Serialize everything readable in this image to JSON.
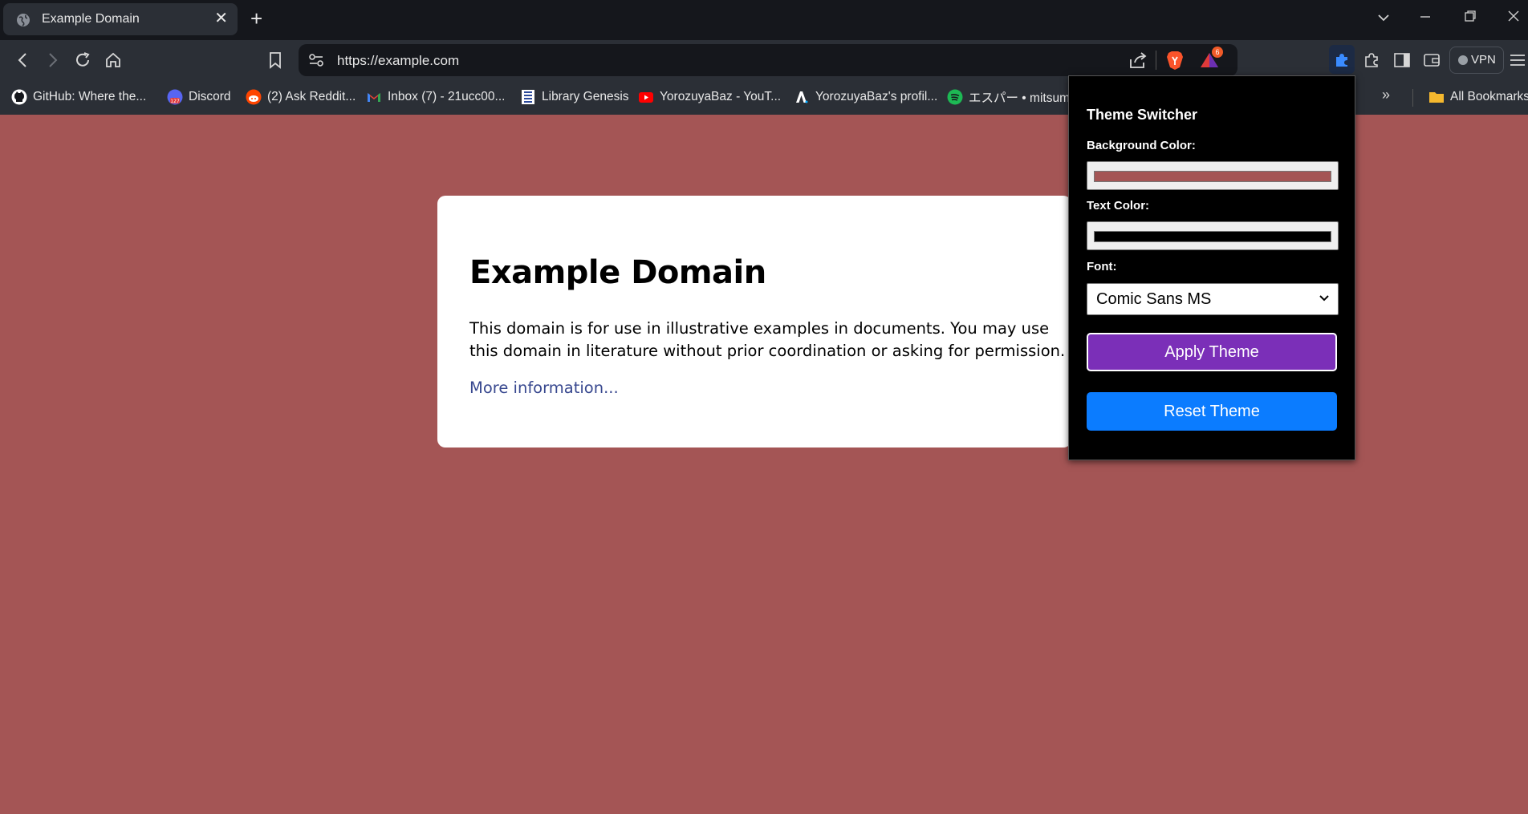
{
  "tab": {
    "title": "Example Domain"
  },
  "address_bar": {
    "url": "https://example.com",
    "brave_badge_count": "6"
  },
  "toolbar": {
    "vpn_label": "VPN"
  },
  "bookmarks": [
    {
      "label": "GitHub: Where the...",
      "icon": "github-icon"
    },
    {
      "label": "Discord",
      "icon": "discord-icon"
    },
    {
      "label": "(2) Ask Reddit...",
      "icon": "reddit-icon"
    },
    {
      "label": "Inbox (7) - 21ucc00...",
      "icon": "gmail-icon"
    },
    {
      "label": "Library Genesis",
      "icon": "libgen-icon"
    },
    {
      "label": "YorozuyaBaz - YouT...",
      "icon": "youtube-icon"
    },
    {
      "label": "YorozuyaBaz's profil...",
      "icon": "anilist-icon"
    },
    {
      "label": "エスパー • mitsume",
      "icon": "spotify-icon"
    }
  ],
  "bookmarks_all": "All Bookmarks",
  "page": {
    "heading": "Example Domain",
    "paragraph": "This domain is for use in illustrative examples in documents. You may use this domain in literature without prior coordination or asking for permission.",
    "link": "More information..."
  },
  "popup": {
    "title": "Theme Switcher",
    "bg_label": "Background Color:",
    "bg_value": "#a45555",
    "text_label": "Text Color:",
    "text_value": "#000000",
    "font_label": "Font:",
    "font_value": "Comic Sans MS",
    "apply_label": "Apply Theme",
    "reset_label": "Reset Theme"
  },
  "colors": {
    "page_bg": "#a45555",
    "apply": "#7b2fb8",
    "reset": "#0b7cff",
    "link": "#38488f"
  }
}
